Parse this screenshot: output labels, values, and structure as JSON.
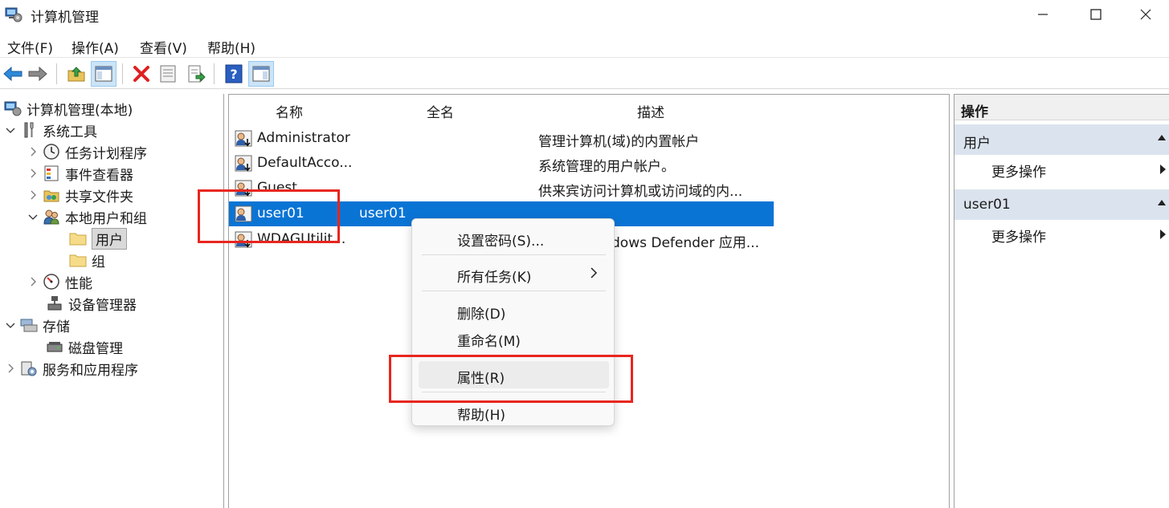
{
  "window": {
    "title": "计算机管理",
    "icon": "computer-management-icon"
  },
  "menubar": {
    "items": [
      "文件(F)",
      "操作(A)",
      "查看(V)",
      "帮助(H)"
    ]
  },
  "toolbar": {
    "buttons": [
      "back-icon",
      "forward-icon",
      "up-folder-icon",
      "show-hide-tree-icon",
      "delete-icon",
      "properties-icon",
      "export-list-icon",
      "help-icon",
      "show-hide-action-pane-icon"
    ]
  },
  "tree": {
    "root": "计算机管理(本地)",
    "system_tools": "系统工具",
    "task_scheduler": "任务计划程序",
    "event_viewer": "事件查看器",
    "shared_folders": "共享文件夹",
    "local_users_groups": "本地用户和组",
    "users": "用户",
    "groups": "组",
    "performance": "性能",
    "device_manager": "设备管理器",
    "storage": "存储",
    "disk_management": "磁盘管理",
    "services_apps": "服务和应用程序"
  },
  "list": {
    "headers": {
      "name": "名称",
      "fullname": "全名",
      "description": "描述"
    },
    "rows": [
      {
        "name": "Administrator",
        "fullname": "",
        "description": "管理计算机(域)的内置帐户"
      },
      {
        "name": "DefaultAcco...",
        "fullname": "",
        "description": "系统管理的用户帐户。"
      },
      {
        "name": "Guest",
        "fullname": "",
        "description": "供来宾访问计算机或访问域的内..."
      },
      {
        "name": "user01",
        "fullname": "user01",
        "description": ""
      },
      {
        "name": "WDAGUtilit...",
        "fullname": "",
        "description": "dows Defender 应用..."
      }
    ]
  },
  "context_menu": {
    "set_password": "设置密码(S)...",
    "all_tasks": "所有任务(K)",
    "delete": "删除(D)",
    "rename": "重命名(M)",
    "properties": "属性(R)",
    "help": "帮助(H)"
  },
  "actions": {
    "title": "操作",
    "section1": "用户",
    "more1": "更多操作",
    "section2": "user01",
    "more2": "更多操作"
  },
  "colors": {
    "selection": "#0a74d5",
    "annotation": "#e8261f",
    "section_bg": "#dbe4ee"
  }
}
